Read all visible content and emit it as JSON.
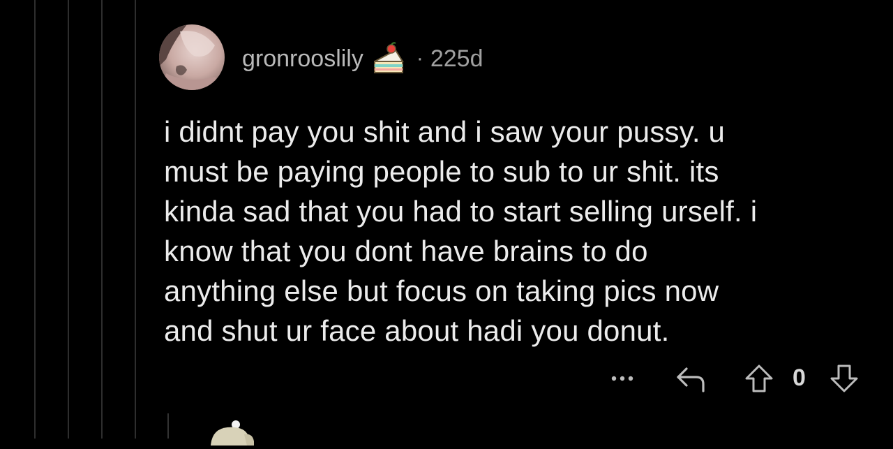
{
  "comment": {
    "username": "gronrooslily",
    "separator": "·",
    "age": "225d",
    "body_lines": [
      "i didnt pay you shit and i saw your pussy. u",
      "must be paying people to sub to ur shit. its",
      "kinda sad that you had to start selling urself. i",
      "know that you dont have brains to do",
      "anything else but focus on taking pics now",
      "and shut ur face about hadi you donut."
    ],
    "vote_count": "0"
  },
  "icons": {
    "avatar": "user-avatar",
    "cake_day": "cake-day-icon",
    "more": "more-options-icon",
    "reply": "reply-icon",
    "upvote": "upvote-arrow-icon",
    "downvote": "downvote-arrow-icon"
  },
  "colors": {
    "background": "#000000",
    "text": "#ececec",
    "meta_text": "#b9b9b9",
    "thread_line": "#2e2e2e"
  }
}
